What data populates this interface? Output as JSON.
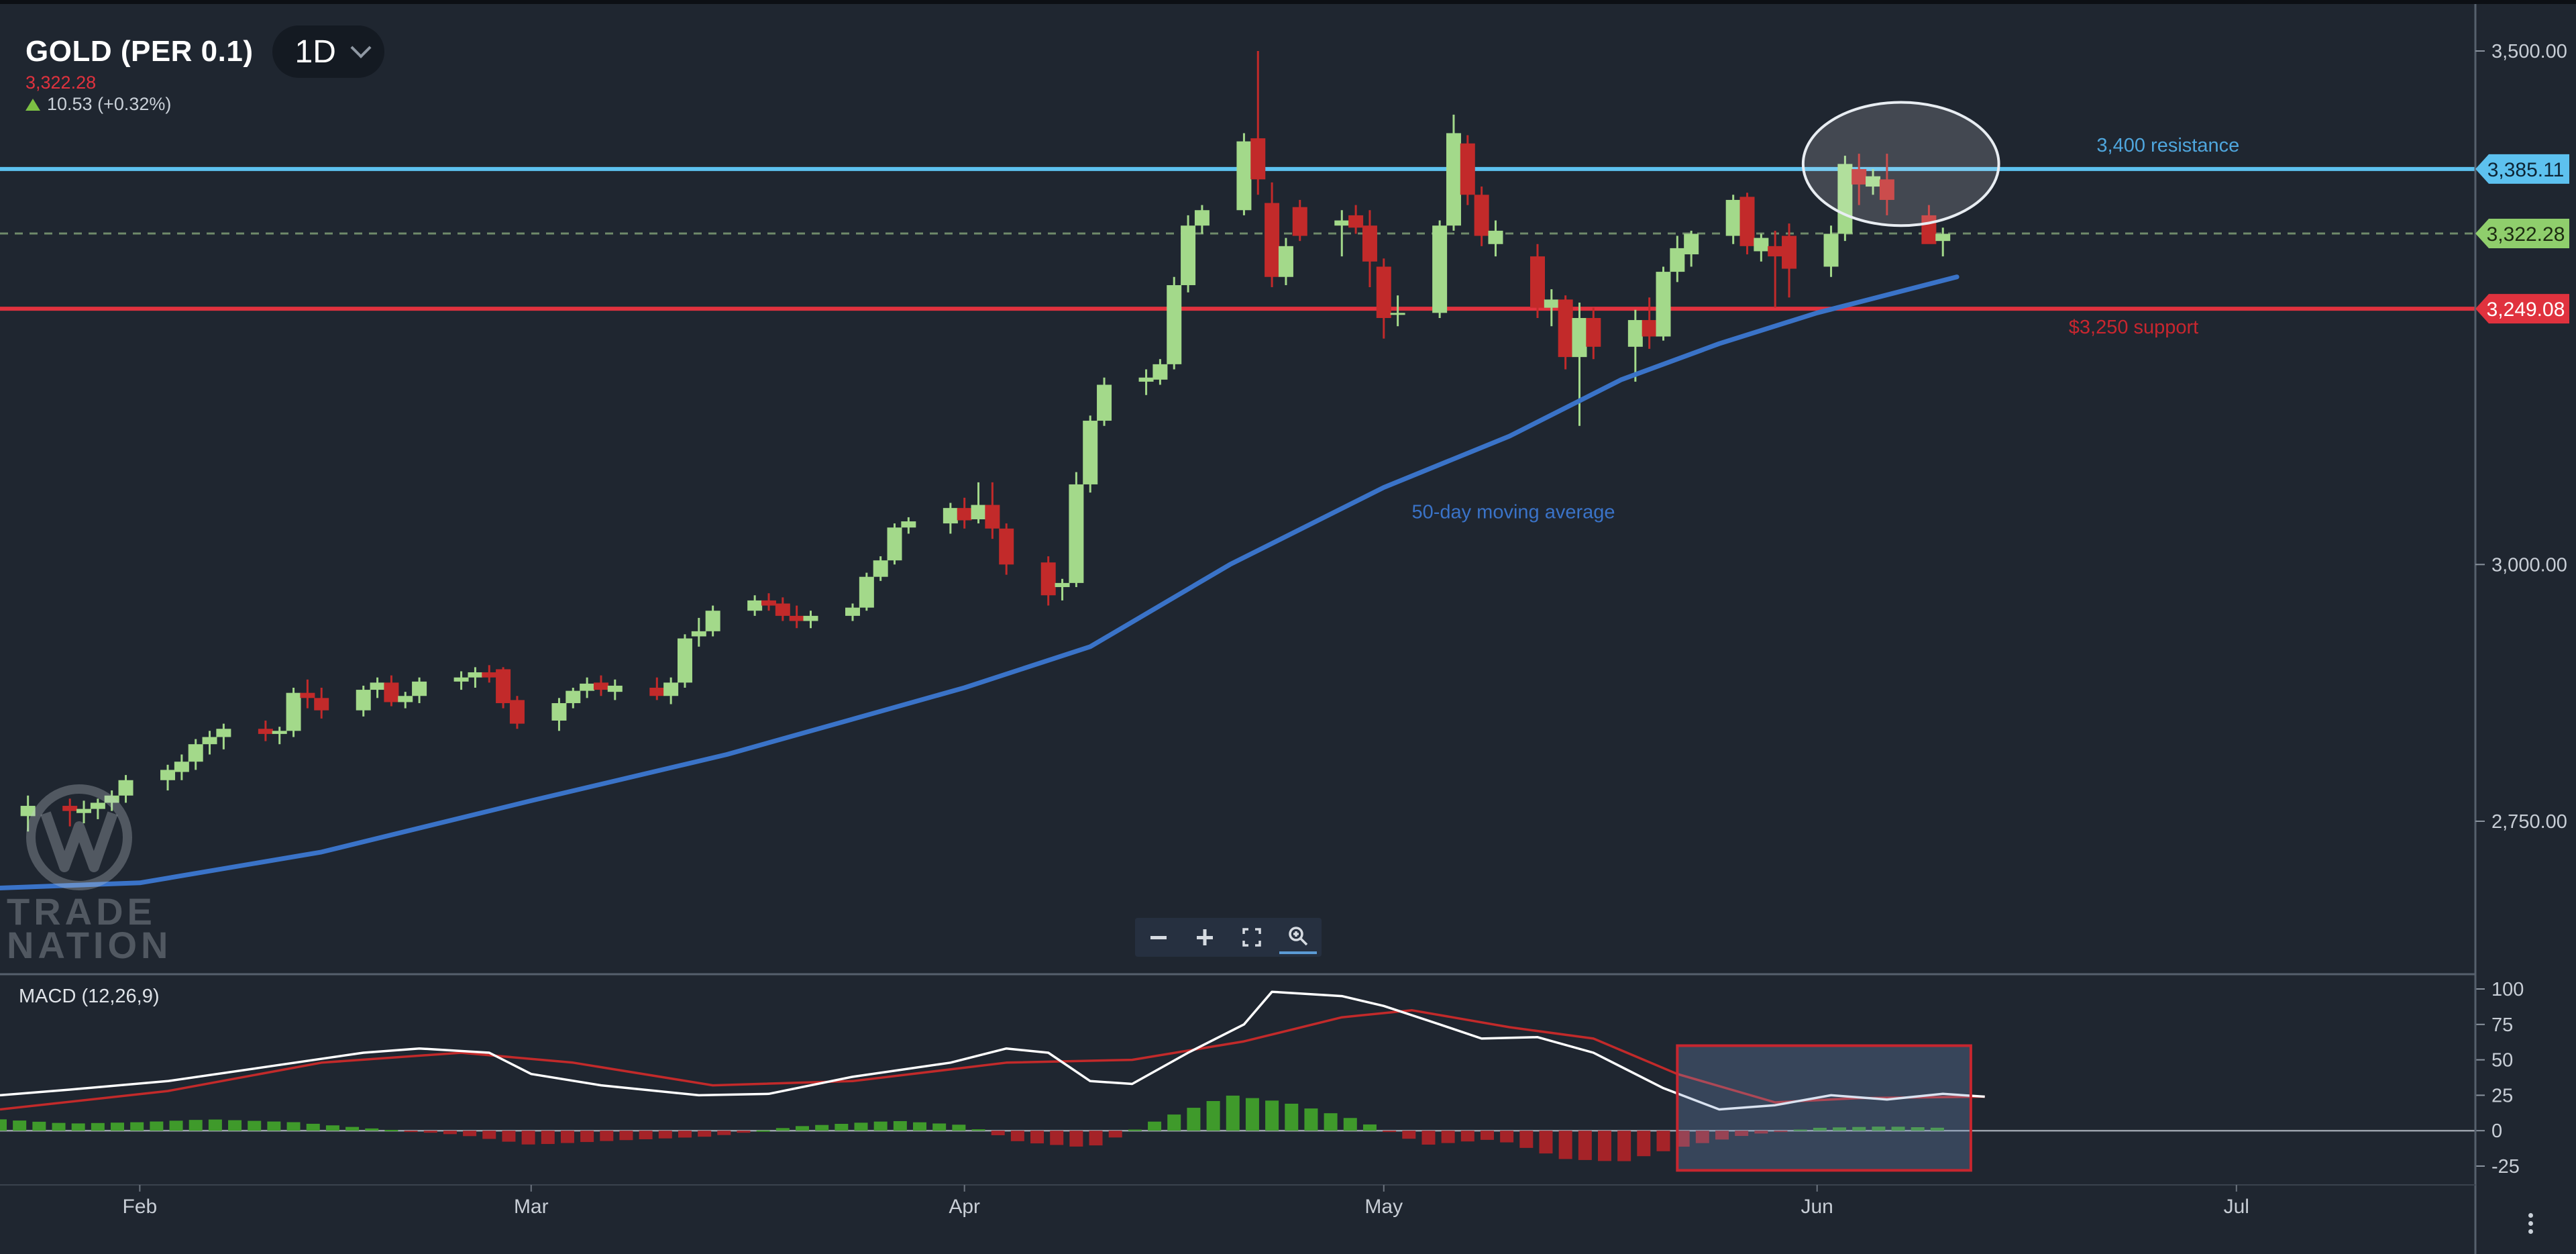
{
  "header": {
    "symbol": "GOLD (PER 0.1)",
    "timeframe": "1D",
    "last_price": "3,322.28",
    "change": "10.53 (+0.32%)"
  },
  "watermark": {
    "line1": "TRADE",
    "line2": "NATION"
  },
  "zoom_controls": [
    "zoom-out",
    "zoom-in",
    "fullscreen",
    "zoom-reset"
  ],
  "chart_data": [
    {
      "type": "candlestick",
      "title": "GOLD (PER 0.1)",
      "interval": "1D",
      "ylim": [
        2655,
        3530
      ],
      "y_ticks": [
        {
          "value": 3500,
          "label": "3,500.00"
        },
        {
          "value": 3000,
          "label": "3,000.00"
        },
        {
          "value": 2750,
          "label": "2,750.00"
        }
      ],
      "x_ticks": [
        {
          "date": "2025-02-01",
          "label": "Feb"
        },
        {
          "date": "2025-03-01",
          "label": "Mar"
        },
        {
          "date": "2025-04-01",
          "label": "Apr"
        },
        {
          "date": "2025-05-01",
          "label": "May"
        },
        {
          "date": "2025-06-01",
          "label": "Jun"
        },
        {
          "date": "2025-07-01",
          "label": "Jul"
        }
      ],
      "x_range": [
        "2025-01-22",
        "2025-07-18"
      ],
      "candles": [
        [
          "2025-01-24",
          2755,
          2775,
          2740,
          2765
        ],
        [
          "2025-01-27",
          2765,
          2772,
          2745,
          2760
        ],
        [
          "2025-01-28",
          2758,
          2770,
          2748,
          2762
        ],
        [
          "2025-01-29",
          2762,
          2772,
          2752,
          2768
        ],
        [
          "2025-01-30",
          2768,
          2780,
          2760,
          2775
        ],
        [
          "2025-01-31",
          2775,
          2795,
          2768,
          2790
        ],
        [
          "2025-02-03",
          2790,
          2805,
          2780,
          2800
        ],
        [
          "2025-02-04",
          2798,
          2815,
          2790,
          2808
        ],
        [
          "2025-02-05",
          2808,
          2830,
          2800,
          2825
        ],
        [
          "2025-02-06",
          2825,
          2838,
          2815,
          2832
        ],
        [
          "2025-02-07",
          2832,
          2845,
          2820,
          2840
        ],
        [
          "2025-02-10",
          2840,
          2848,
          2828,
          2835
        ],
        [
          "2025-02-11",
          2835,
          2842,
          2825,
          2838
        ],
        [
          "2025-02-12",
          2838,
          2880,
          2832,
          2875
        ],
        [
          "2025-02-13",
          2875,
          2888,
          2860,
          2870
        ],
        [
          "2025-02-14",
          2870,
          2880,
          2850,
          2858
        ],
        [
          "2025-02-17",
          2858,
          2882,
          2852,
          2878
        ],
        [
          "2025-02-18",
          2878,
          2890,
          2870,
          2885
        ],
        [
          "2025-02-19",
          2885,
          2892,
          2862,
          2866
        ],
        [
          "2025-02-20",
          2866,
          2876,
          2860,
          2872
        ],
        [
          "2025-02-21",
          2872,
          2890,
          2865,
          2886
        ],
        [
          "2025-02-24",
          2886,
          2896,
          2878,
          2890
        ],
        [
          "2025-02-25",
          2890,
          2900,
          2880,
          2895
        ],
        [
          "2025-02-26",
          2895,
          2902,
          2885,
          2890
        ],
        [
          "2025-02-27",
          2898,
          2900,
          2860,
          2865
        ],
        [
          "2025-02-28",
          2868,
          2872,
          2840,
          2845
        ],
        [
          "2025-03-03",
          2848,
          2870,
          2838,
          2865
        ],
        [
          "2025-03-04",
          2865,
          2880,
          2860,
          2877
        ],
        [
          "2025-03-05",
          2877,
          2890,
          2870,
          2884
        ],
        [
          "2025-03-06",
          2885,
          2892,
          2872,
          2878
        ],
        [
          "2025-03-07",
          2876,
          2888,
          2868,
          2882
        ],
        [
          "2025-03-10",
          2880,
          2890,
          2868,
          2872
        ],
        [
          "2025-03-11",
          2872,
          2890,
          2864,
          2885
        ],
        [
          "2025-03-12",
          2885,
          2932,
          2880,
          2928
        ],
        [
          "2025-03-13",
          2930,
          2948,
          2920,
          2935
        ],
        [
          "2025-03-14",
          2935,
          2960,
          2930,
          2955
        ],
        [
          "2025-03-17",
          2955,
          2970,
          2950,
          2965
        ],
        [
          "2025-03-18",
          2965,
          2972,
          2955,
          2960
        ],
        [
          "2025-03-19",
          2962,
          2968,
          2945,
          2950
        ],
        [
          "2025-03-20",
          2950,
          2960,
          2938,
          2945
        ],
        [
          "2025-03-21",
          2945,
          2955,
          2938,
          2950
        ],
        [
          "2025-03-24",
          2950,
          2962,
          2945,
          2958
        ],
        [
          "2025-03-25",
          2958,
          2992,
          2955,
          2988
        ],
        [
          "2025-03-26",
          2988,
          3008,
          2984,
          3004
        ],
        [
          "2025-03-27",
          3004,
          3040,
          3000,
          3036
        ],
        [
          "2025-03-28",
          3036,
          3046,
          3030,
          3042
        ],
        [
          "2025-03-31",
          3040,
          3060,
          3030,
          3055
        ],
        [
          "2025-04-01",
          3055,
          3065,
          3035,
          3043
        ],
        [
          "2025-04-02",
          3044,
          3080,
          3040,
          3058
        ],
        [
          "2025-04-03",
          3058,
          3080,
          3025,
          3035
        ],
        [
          "2025-04-04",
          3035,
          3040,
          2990,
          3000
        ],
        [
          "2025-04-07",
          3002,
          3008,
          2960,
          2970
        ],
        [
          "2025-04-08",
          2978,
          2986,
          2965,
          2982
        ],
        [
          "2025-04-09",
          2982,
          3090,
          2978,
          3078
        ],
        [
          "2025-04-10",
          3078,
          3145,
          3070,
          3140
        ],
        [
          "2025-04-11",
          3140,
          3182,
          3135,
          3175
        ],
        [
          "2025-04-14",
          3178,
          3190,
          3165,
          3182
        ],
        [
          "2025-04-15",
          3180,
          3200,
          3175,
          3195
        ],
        [
          "2025-04-16",
          3195,
          3280,
          3190,
          3272
        ],
        [
          "2025-04-17",
          3272,
          3340,
          3265,
          3330
        ],
        [
          "2025-04-18",
          3330,
          3350,
          3322,
          3345
        ],
        [
          "2025-04-21",
          3345,
          3420,
          3340,
          3412
        ],
        [
          "2025-04-22",
          3415,
          3500,
          3360,
          3375
        ],
        [
          "2025-04-23",
          3352,
          3372,
          3270,
          3280
        ],
        [
          "2025-04-24",
          3280,
          3318,
          3272,
          3310
        ],
        [
          "2025-04-25",
          3348,
          3355,
          3315,
          3320
        ],
        [
          "2025-04-28",
          3330,
          3345,
          3300,
          3335
        ],
        [
          "2025-04-29",
          3340,
          3350,
          3322,
          3328
        ],
        [
          "2025-04-30",
          3330,
          3345,
          3270,
          3295
        ],
        [
          "2025-05-01",
          3290,
          3298,
          3220,
          3240
        ],
        [
          "2025-05-02",
          3245,
          3262,
          3232,
          3245
        ],
        [
          "2025-05-05",
          3245,
          3335,
          3240,
          3330
        ],
        [
          "2025-05-06",
          3330,
          3438,
          3325,
          3420
        ],
        [
          "2025-05-07",
          3410,
          3418,
          3350,
          3360
        ],
        [
          "2025-05-08",
          3360,
          3368,
          3310,
          3320
        ],
        [
          "2025-05-09",
          3312,
          3335,
          3300,
          3325
        ],
        [
          "2025-05-12",
          3300,
          3312,
          3240,
          3250
        ],
        [
          "2025-05-13",
          3250,
          3268,
          3232,
          3258
        ],
        [
          "2025-05-14",
          3258,
          3262,
          3190,
          3202
        ],
        [
          "2025-05-15",
          3202,
          3255,
          3135,
          3240
        ],
        [
          "2025-05-16",
          3240,
          3250,
          3200,
          3212
        ],
        [
          "2025-05-19",
          3212,
          3248,
          3178,
          3238
        ],
        [
          "2025-05-20",
          3238,
          3260,
          3210,
          3222
        ],
        [
          "2025-05-21",
          3222,
          3290,
          3218,
          3285
        ],
        [
          "2025-05-22",
          3285,
          3320,
          3275,
          3308
        ],
        [
          "2025-05-23",
          3302,
          3325,
          3290,
          3322
        ],
        [
          "2025-05-26",
          3320,
          3360,
          3312,
          3355
        ],
        [
          "2025-05-27",
          3358,
          3362,
          3302,
          3310
        ],
        [
          "2025-05-28",
          3305,
          3322,
          3295,
          3318
        ],
        [
          "2025-05-29",
          3310,
          3325,
          3250,
          3300
        ],
        [
          "2025-05-30",
          3320,
          3332,
          3260,
          3288
        ],
        [
          "2025-06-02",
          3290,
          3330,
          3280,
          3322
        ],
        [
          "2025-06-03",
          3322,
          3398,
          3315,
          3390
        ],
        [
          "2025-06-04",
          3385,
          3400,
          3350,
          3370
        ],
        [
          "2025-06-05",
          3368,
          3385,
          3360,
          3378
        ],
        [
          "2025-06-06",
          3375,
          3400,
          3340,
          3355
        ],
        [
          "2025-06-09",
          3340,
          3350,
          3318,
          3312
        ],
        [
          "2025-06-10",
          3315,
          3328,
          3300,
          3322
        ]
      ],
      "colors": {
        "up": "#a3d98a",
        "down": "#c22a2a",
        "background": "#1f2630",
        "ma": "#3a73c8"
      },
      "moving_average": {
        "name": "50-day moving average",
        "points": [
          [
            "2025-01-22",
            2685
          ],
          [
            "2025-02-01",
            2690
          ],
          [
            "2025-02-14",
            2720
          ],
          [
            "2025-03-01",
            2770
          ],
          [
            "2025-03-15",
            2815
          ],
          [
            "2025-04-01",
            2880
          ],
          [
            "2025-04-10",
            2920
          ],
          [
            "2025-04-20",
            3000
          ],
          [
            "2025-05-01",
            3075
          ],
          [
            "2025-05-10",
            3125
          ],
          [
            "2025-05-18",
            3180
          ],
          [
            "2025-05-25",
            3215
          ],
          [
            "2025-06-01",
            3245
          ],
          [
            "2025-06-11",
            3280
          ]
        ]
      },
      "horizontal_lines": [
        {
          "value": 3385.11,
          "label": "3,385.11",
          "color": "#5dc1ef",
          "style": "solid",
          "note": "3,400 resistance"
        },
        {
          "value": 3322.28,
          "label": "3,322.28",
          "color": "#8fce6c",
          "style": "dashed",
          "note": ""
        },
        {
          "value": 3249.08,
          "label": "3,249.08",
          "color": "#e0323e",
          "style": "solid",
          "note": "$3,250 support"
        }
      ],
      "annotations": [
        {
          "text": "3,400 resistance",
          "color": "#4fa6dd",
          "at": [
            "2025-06-21",
            3402
          ]
        },
        {
          "text": "$3,250 support",
          "color": "#c8262f",
          "at": [
            "2025-06-19",
            3225
          ]
        },
        {
          "text": "50-day moving average",
          "color": "#3a73c8",
          "at": [
            "2025-05-03",
            3045
          ]
        }
      ],
      "highlight_ellipse": {
        "x_range": [
          "2025-05-31",
          "2025-06-14"
        ],
        "y_range": [
          3330,
          3450
        ]
      }
    },
    {
      "type": "line+bar",
      "title": "MACD (12,26,9)",
      "ylim": [
        -35,
        112
      ],
      "y_ticks": [
        {
          "value": 100,
          "label": "100"
        },
        {
          "value": 75,
          "label": "75"
        },
        {
          "value": 50,
          "label": "50"
        },
        {
          "value": 25,
          "label": "25"
        },
        {
          "value": 0,
          "label": "0"
        },
        {
          "value": -25,
          "label": "-25"
        }
      ],
      "macd_line": [
        [
          "2025-01-22",
          25
        ],
        [
          "2025-01-27",
          29
        ],
        [
          "2025-02-03",
          35
        ],
        [
          "2025-02-10",
          45
        ],
        [
          "2025-02-17",
          55
        ],
        [
          "2025-02-21",
          58
        ],
        [
          "2025-02-26",
          55
        ],
        [
          "2025-03-01",
          40
        ],
        [
          "2025-03-06",
          32
        ],
        [
          "2025-03-13",
          25
        ],
        [
          "2025-03-18",
          26
        ],
        [
          "2025-03-24",
          38
        ],
        [
          "2025-03-31",
          48
        ],
        [
          "2025-04-04",
          58
        ],
        [
          "2025-04-07",
          55
        ],
        [
          "2025-04-10",
          35
        ],
        [
          "2025-04-13",
          33
        ],
        [
          "2025-04-17",
          55
        ],
        [
          "2025-04-21",
          75
        ],
        [
          "2025-04-23",
          98
        ],
        [
          "2025-04-28",
          95
        ],
        [
          "2025-05-01",
          88
        ],
        [
          "2025-05-05",
          75
        ],
        [
          "2025-05-08",
          65
        ],
        [
          "2025-05-12",
          66
        ],
        [
          "2025-05-16",
          55
        ],
        [
          "2025-05-21",
          30
        ],
        [
          "2025-05-25",
          15
        ],
        [
          "2025-05-29",
          18
        ],
        [
          "2025-06-02",
          25
        ],
        [
          "2025-06-06",
          22
        ],
        [
          "2025-06-10",
          26
        ],
        [
          "2025-06-13",
          24
        ]
      ],
      "signal_line": [
        [
          "2025-01-22",
          15
        ],
        [
          "2025-02-03",
          28
        ],
        [
          "2025-02-14",
          48
        ],
        [
          "2025-02-24",
          55
        ],
        [
          "2025-03-04",
          48
        ],
        [
          "2025-03-14",
          32
        ],
        [
          "2025-03-24",
          35
        ],
        [
          "2025-04-04",
          48
        ],
        [
          "2025-04-13",
          50
        ],
        [
          "2025-04-21",
          63
        ],
        [
          "2025-04-28",
          80
        ],
        [
          "2025-05-03",
          85
        ],
        [
          "2025-05-10",
          73
        ],
        [
          "2025-05-16",
          65
        ],
        [
          "2025-05-22",
          40
        ],
        [
          "2025-05-29",
          20
        ],
        [
          "2025-06-04",
          23
        ],
        [
          "2025-06-13",
          24
        ]
      ],
      "histogram": [
        [
          "2025-01-22",
          8
        ],
        [
          "2025-01-27",
          5
        ],
        [
          "2025-02-01",
          6
        ],
        [
          "2025-02-06",
          8
        ],
        [
          "2025-02-12",
          6
        ],
        [
          "2025-02-17",
          2
        ],
        [
          "2025-02-24",
          -3
        ],
        [
          "2025-03-01",
          -10
        ],
        [
          "2025-03-07",
          -7
        ],
        [
          "2025-03-14",
          -4
        ],
        [
          "2025-03-20",
          3
        ],
        [
          "2025-03-27",
          7
        ],
        [
          "2025-04-01",
          4
        ],
        [
          "2025-04-05",
          -8
        ],
        [
          "2025-04-10",
          -12
        ],
        [
          "2025-04-15",
          8
        ],
        [
          "2025-04-20",
          25
        ],
        [
          "2025-04-24",
          20
        ],
        [
          "2025-04-29",
          8
        ],
        [
          "2025-05-04",
          -10
        ],
        [
          "2025-05-09",
          -6
        ],
        [
          "2025-05-14",
          -20
        ],
        [
          "2025-05-18",
          -22
        ],
        [
          "2025-05-22",
          -12
        ],
        [
          "2025-05-27",
          -3
        ],
        [
          "2025-06-01",
          2
        ],
        [
          "2025-06-06",
          3
        ],
        [
          "2025-06-10",
          2
        ]
      ],
      "colors": {
        "macd": "#ffffff",
        "signal": "#c22a2a",
        "hist_up": "#3f9a2b",
        "hist_down": "#a52328"
      },
      "highlight_rect": {
        "x_range": [
          "2025-05-22",
          "2025-06-12"
        ],
        "y_range": [
          -28,
          60
        ]
      }
    }
  ]
}
